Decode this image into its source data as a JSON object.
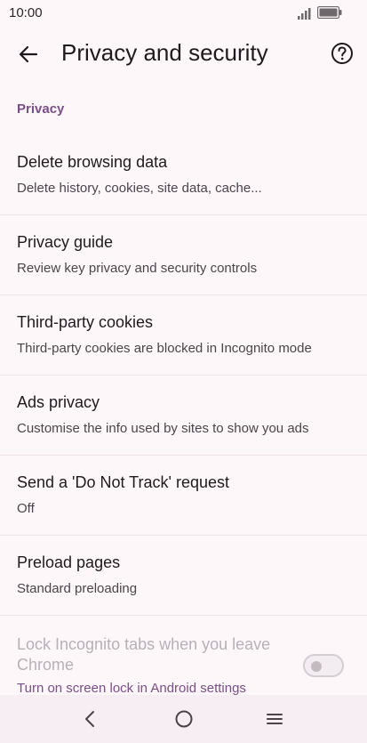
{
  "status_bar": {
    "time": "10:00"
  },
  "app_bar": {
    "title": "Privacy and security",
    "back_icon": "arrow-back-icon",
    "help_icon": "help-circle-icon"
  },
  "section": {
    "header": "Privacy"
  },
  "items": [
    {
      "title": "Delete browsing data",
      "subtitle": "Delete history, cookies, site data, cache..."
    },
    {
      "title": "Privacy guide",
      "subtitle": "Review key privacy and security controls"
    },
    {
      "title": "Third-party cookies",
      "subtitle": "Third-party cookies are blocked in Incognito mode"
    },
    {
      "title": "Ads privacy",
      "subtitle": "Customise the info used by sites to show you ads"
    },
    {
      "title": "Send a 'Do Not Track' request",
      "subtitle": "Off"
    },
    {
      "title": "Preload pages",
      "subtitle": "Standard preloading"
    }
  ],
  "lock_item": {
    "title": "Lock Incognito tabs when you leave Chrome",
    "link": "Turn on screen lock in Android settings",
    "toggle_on": false,
    "disabled": true
  },
  "colors": {
    "background": "#fdf7fa",
    "accent": "#7b4f86",
    "divider": "#efe2e9"
  }
}
